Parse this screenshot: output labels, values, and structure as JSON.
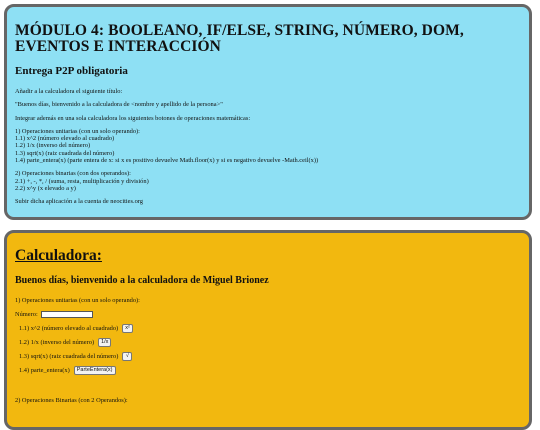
{
  "assignment": {
    "title": "MÓDULO 4: BOOLEANO, IF/ELSE, STRING, NÚMERO, DOM, EVENTOS E INTERACCIÓN",
    "subtitle": "Entrega P2P obligatoria",
    "lines": [
      "Añadir a la calculadora el siguiente título:",
      "\"Buenos días, bienvenido a la calculadora de <nombre y apellido de la persona>\"",
      "Integrar además en una sola calculadora los siguientes botones de operaciones matemáticas:",
      "1) Operaciones unitarias (con un solo operando):",
      "1.1) x^2 (número elevado al cuadrado)",
      "1.2) 1/x (inverso del número)",
      "1.3) sqrt(x) (raiz cuadrada del número)",
      "1.4) parte_entera(x) (parte entera de x: si x es positivo devuelve Math.floor(x) y si es negativo devuelve -Math.ceil(x))",
      "2) Operaciones binarias (con dos operandos):",
      "2.1) +, -, *, / (suma, resta, multiplicación y división)",
      "2.2) x^y (x elevado a y)",
      "Subir dicha aplicación a la cuenta de neocities.org"
    ]
  },
  "calculator": {
    "title": "Calculadora:",
    "greeting": "Buenos días, bienvenido a la calculadora de Miguel Brionez",
    "unary_heading": "1) Operaciones unitarias (con un solo operando):",
    "number_label": "Número:",
    "number_value": "",
    "ops": [
      {
        "label": "1.1) x^2 (número elevado al cuadrado)",
        "button": "x²"
      },
      {
        "label": "1.2) 1/x (inverso del número)",
        "button": "1/x"
      },
      {
        "label": "1.3) sqrt(x) (raiz cuadrada del número)",
        "button": "√"
      },
      {
        "label": "1.4) parte_entera(x)",
        "button": "ParteEntera(x)"
      }
    ],
    "binary_heading": "2) Operaciones Binarias (con 2 Operandos):"
  }
}
